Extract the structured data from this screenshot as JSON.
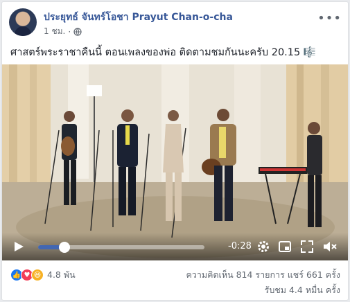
{
  "post": {
    "author": "ประยุทธ์ จันทร์โอชา Prayut Chan-o-cha",
    "time": "1 ชม.",
    "separator": "·",
    "message": "ศาสตร์พระราชาคืนนี้ ตอนเพลงของพ่อ ติดตามชมกันนะครับ 20.15 🎼",
    "more_icon": "more-horizontal-icon",
    "privacy_icon": "globe-icon"
  },
  "video": {
    "time_remaining": "-0:28",
    "progress_fraction": 0.16,
    "icons": [
      "play-icon",
      "settings-icon",
      "pip-icon",
      "fullscreen-icon",
      "volume-muted-icon"
    ]
  },
  "footer": {
    "reaction_count": "4.8 พัน",
    "comments_shares": "ความคิดเห็น 814 รายการ  แชร์ 661 ครั้ง",
    "views": "รับชม 4.4 หมื่น ครั้ง"
  },
  "colors": {
    "author": "#385898",
    "accent": "#4267b2",
    "like": "#1877f2",
    "love": "#f33e58",
    "haha": "#f7b125"
  }
}
